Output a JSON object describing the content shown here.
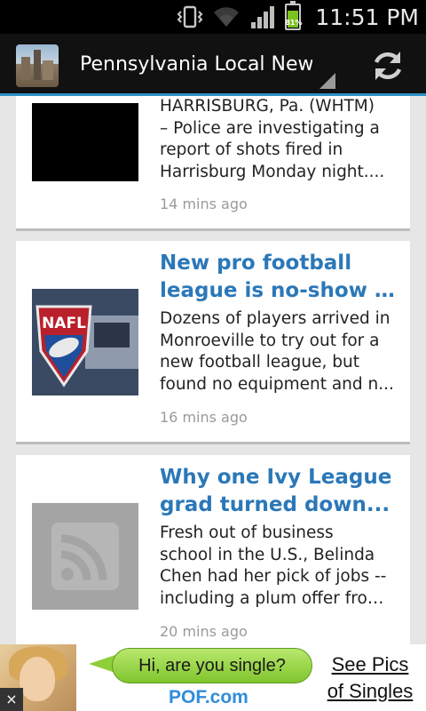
{
  "status_bar": {
    "time": "11:51 PM",
    "battery_percent": "81%",
    "battery_level": 0.81,
    "icons": [
      "vibrate-icon",
      "wifi-icon",
      "signal-icon",
      "battery-icon"
    ]
  },
  "action_bar": {
    "title": "Pennsylvania Local News",
    "icons": [
      "app-icon",
      "refresh-icon"
    ]
  },
  "articles": [
    {
      "headline": "",
      "snippet_lines": [
        "HARRISBURG, Pa. (WHTM)",
        "– Police are investigating a",
        "report of shots fired in",
        "Harrisburg Monday night...."
      ],
      "time": "14 mins ago",
      "thumb": "black-thumbnail"
    },
    {
      "headline_lines": [
        "New pro football",
        "league is no-show a..."
      ],
      "snippet_lines": [
        "Dozens of players arrived in",
        "Monroeville to try out for a",
        "new football league, but",
        "found no equipment and n..."
      ],
      "time": "16 mins ago",
      "thumb": "nafl-logo",
      "thumb_text": "NAFL"
    },
    {
      "headline_lines": [
        "Why one Ivy League",
        "grad turned down..."
      ],
      "snippet_lines": [
        "Fresh out of business",
        "school in the U.S., Belinda",
        "Chen had her pick of jobs --",
        "including a plum offer from..."
      ],
      "time": "20 mins ago",
      "thumb": "rss-placeholder-icon"
    }
  ],
  "ad": {
    "bubble_text": "Hi, are you single?",
    "brand": "POF.com",
    "cta_line1": "See Pics",
    "cta_line2": "of Singles",
    "close": "×"
  },
  "colors": {
    "accent": "#2d8fc4",
    "headline": "#2b78b8",
    "background": "#e6e6e6",
    "battery": "#7bc11f"
  }
}
